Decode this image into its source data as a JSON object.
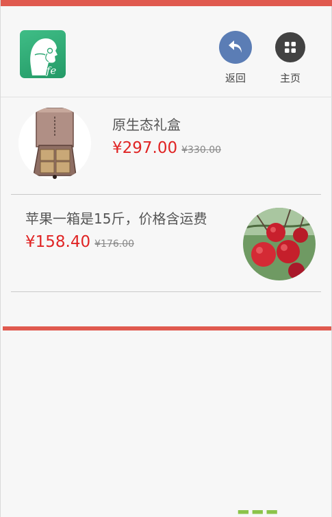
{
  "header": {
    "logo_icon": "ife-logo-icon",
    "back": {
      "label": "返回",
      "icon": "undo-arrow-icon",
      "color": "#5b7db5"
    },
    "home": {
      "label": "主页",
      "icon": "grid-icon",
      "color": "#424242"
    }
  },
  "products": [
    {
      "name": "原生态礼盒",
      "price": "¥297.00",
      "original_price": "¥330.00",
      "image": "wooden-gift-box"
    },
    {
      "name": "苹果一箱是15斤，价格含运费",
      "price": "¥158.40",
      "original_price": "¥176.00",
      "image": "red-apples"
    }
  ],
  "colors": {
    "accent_bar": "#e05a4f",
    "price": "#e02424",
    "logo": "#2fa774"
  }
}
